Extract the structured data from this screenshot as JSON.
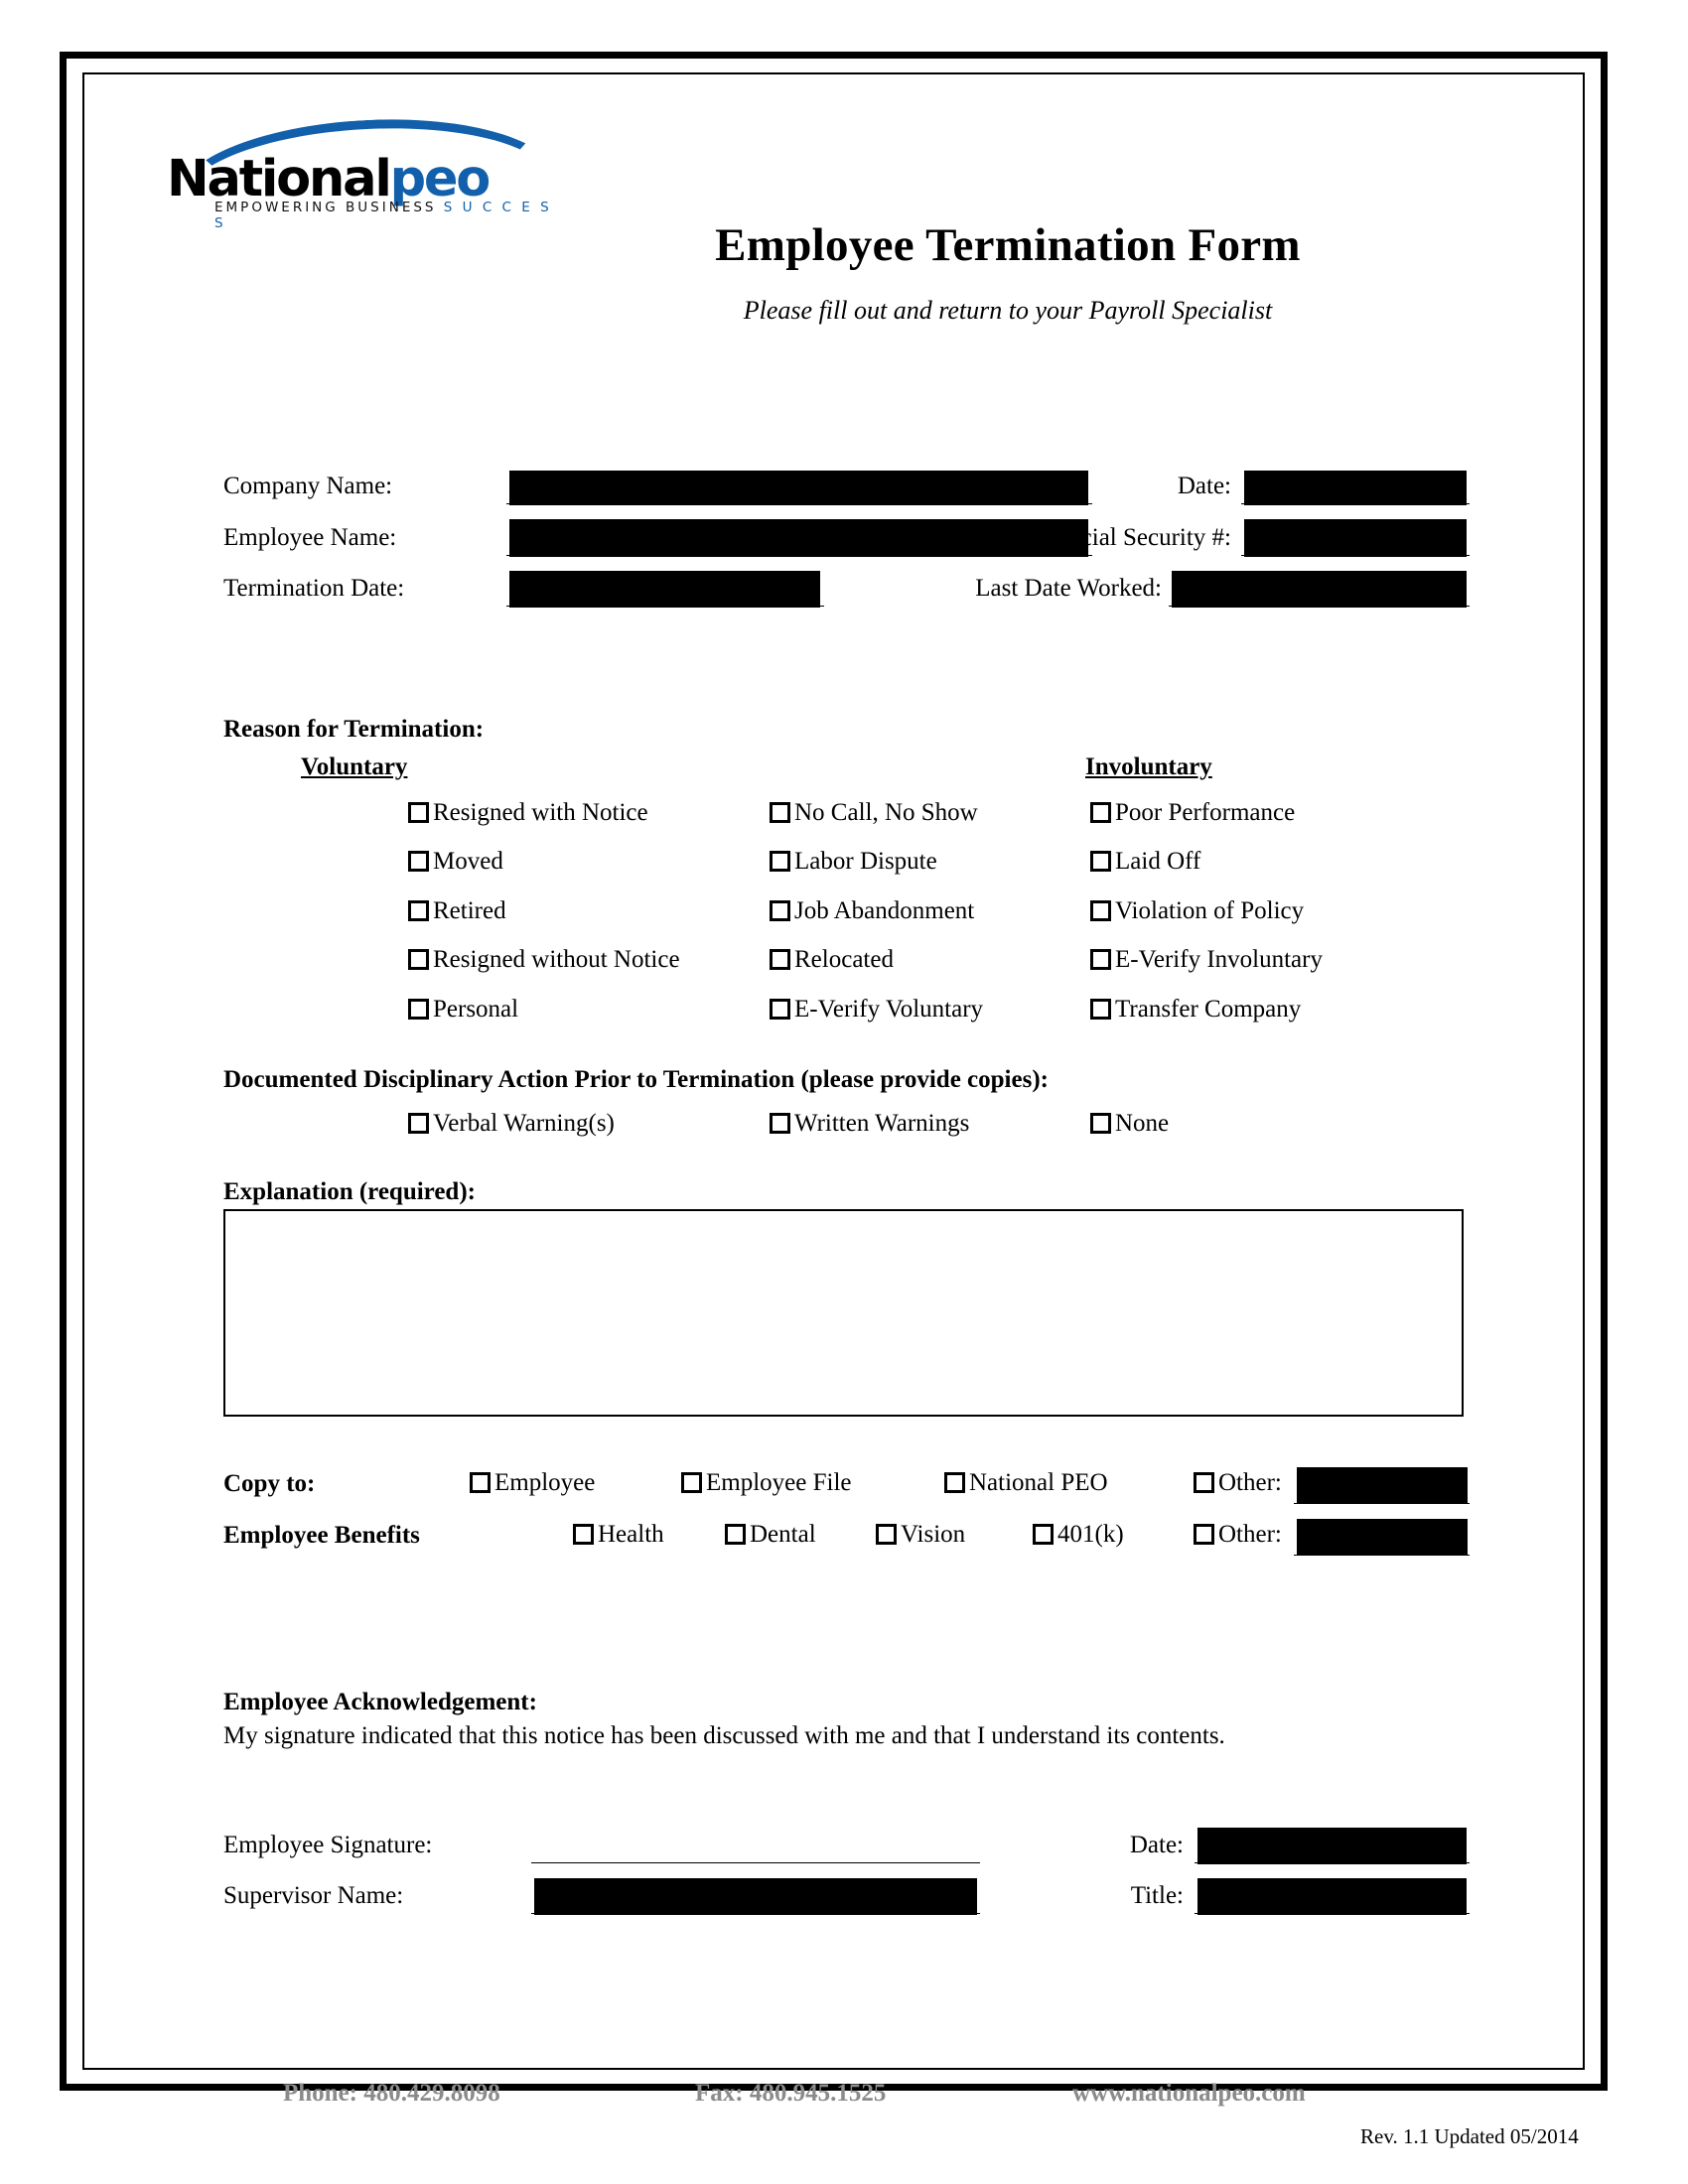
{
  "brand": {
    "logo_primary": "National",
    "logo_secondary": "peo",
    "tagline_primary": "EMPOWERING BUSINESS",
    "tagline_secondary": "S U C C E S S",
    "accent_color": "#1260ab"
  },
  "header": {
    "title": "Employee Termination Form",
    "subtitle": "Please fill out and return to your Payroll Specialist"
  },
  "info_fields": {
    "company_name_label": "Company Name:",
    "date_label": "Date:",
    "employee_name_label": "Employee Name:",
    "ssn_label": "Social Security #:",
    "termination_date_label": "Termination Date:",
    "last_date_worked_label": "Last Date Worked:"
  },
  "reason": {
    "heading": "Reason for Termination:",
    "voluntary_heading": "Voluntary",
    "involuntary_heading": "Involuntary",
    "column_voluntary": [
      "Resigned with Notice",
      "Moved",
      "Retired",
      "Resigned without Notice",
      "Personal"
    ],
    "column_middle": [
      "No Call, No Show",
      "Labor Dispute",
      "Job Abandonment",
      "Relocated",
      "E-Verify Voluntary"
    ],
    "column_involuntary": [
      "Poor Performance",
      "Laid Off",
      "Violation of Policy",
      "E-Verify Involuntary",
      "Transfer Company"
    ]
  },
  "disciplinary": {
    "heading": "Documented Disciplinary Action Prior to Termination (please provide copies):",
    "options": [
      "Verbal Warning(s)",
      "Written Warnings",
      "None"
    ]
  },
  "explanation": {
    "heading": "Explanation (required):",
    "value": ""
  },
  "copy_to": {
    "label": "Copy to:",
    "options": [
      "Employee",
      "Employee File",
      "National PEO"
    ],
    "other_label": "Other:"
  },
  "benefits": {
    "label": "Employee Benefits",
    "options": [
      "Health",
      "Dental",
      "Vision",
      "401(k)"
    ],
    "other_label": "Other:"
  },
  "acknowledgement": {
    "heading": "Employee Acknowledgement:",
    "body": "My signature indicated that this notice has been discussed with me and that I understand its contents."
  },
  "signature": {
    "employee_signature_label": "Employee Signature:",
    "date_label": "Date:",
    "supervisor_name_label": "Supervisor Name:",
    "title_label": "Title:"
  },
  "footer": {
    "phone": "Phone: 480.429.8098",
    "fax": "Fax: 480.945.1525",
    "website": "www.nationalpeo.com",
    "color": "#8b8b8b"
  },
  "revision": {
    "text": "Rev. 1.1  Updated 05/2014"
  }
}
